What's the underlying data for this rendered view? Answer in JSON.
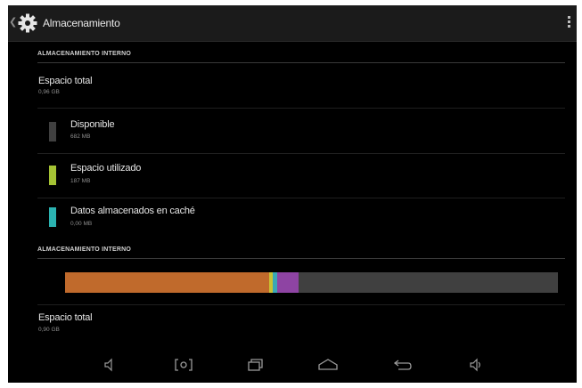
{
  "header": {
    "title": "Almacenamiento"
  },
  "internal_storage": {
    "section_title": "ALMACENAMIENTO INTERNO",
    "total": {
      "label": "Espacio total",
      "value": "0,96 GB"
    },
    "items": [
      {
        "label": "Disponible",
        "value": "682 MB",
        "color": "#404040"
      },
      {
        "label": "Espacio utilizado",
        "value": "187 MB",
        "color": "#a5c334"
      },
      {
        "label": "Datos almacenados en caché",
        "value": "0,00 MB",
        "color": "#2bb3b1"
      }
    ]
  },
  "second_storage": {
    "section_title": "ALMACENAMIENTO INTERNO",
    "usage_segments": [
      {
        "name": "segment-orange",
        "fraction": 0.415,
        "color": "#c06a2c"
      },
      {
        "name": "segment-yellow",
        "fraction": 0.006,
        "color": "#c9c233"
      },
      {
        "name": "segment-teal",
        "fraction": 0.01,
        "color": "#3aa7b6"
      },
      {
        "name": "segment-purple",
        "fraction": 0.042,
        "color": "#8e44a3"
      }
    ],
    "total": {
      "label": "Espacio total",
      "value": "0,90 GB"
    }
  },
  "navbar": {
    "icons": [
      "volume-down-icon",
      "screenshot-icon",
      "recent-apps-icon",
      "home-icon",
      "back-icon",
      "volume-up-icon"
    ]
  },
  "colors": {
    "background": "#000000",
    "actionbar": "#1b1b1b",
    "free_space": "#404040"
  }
}
